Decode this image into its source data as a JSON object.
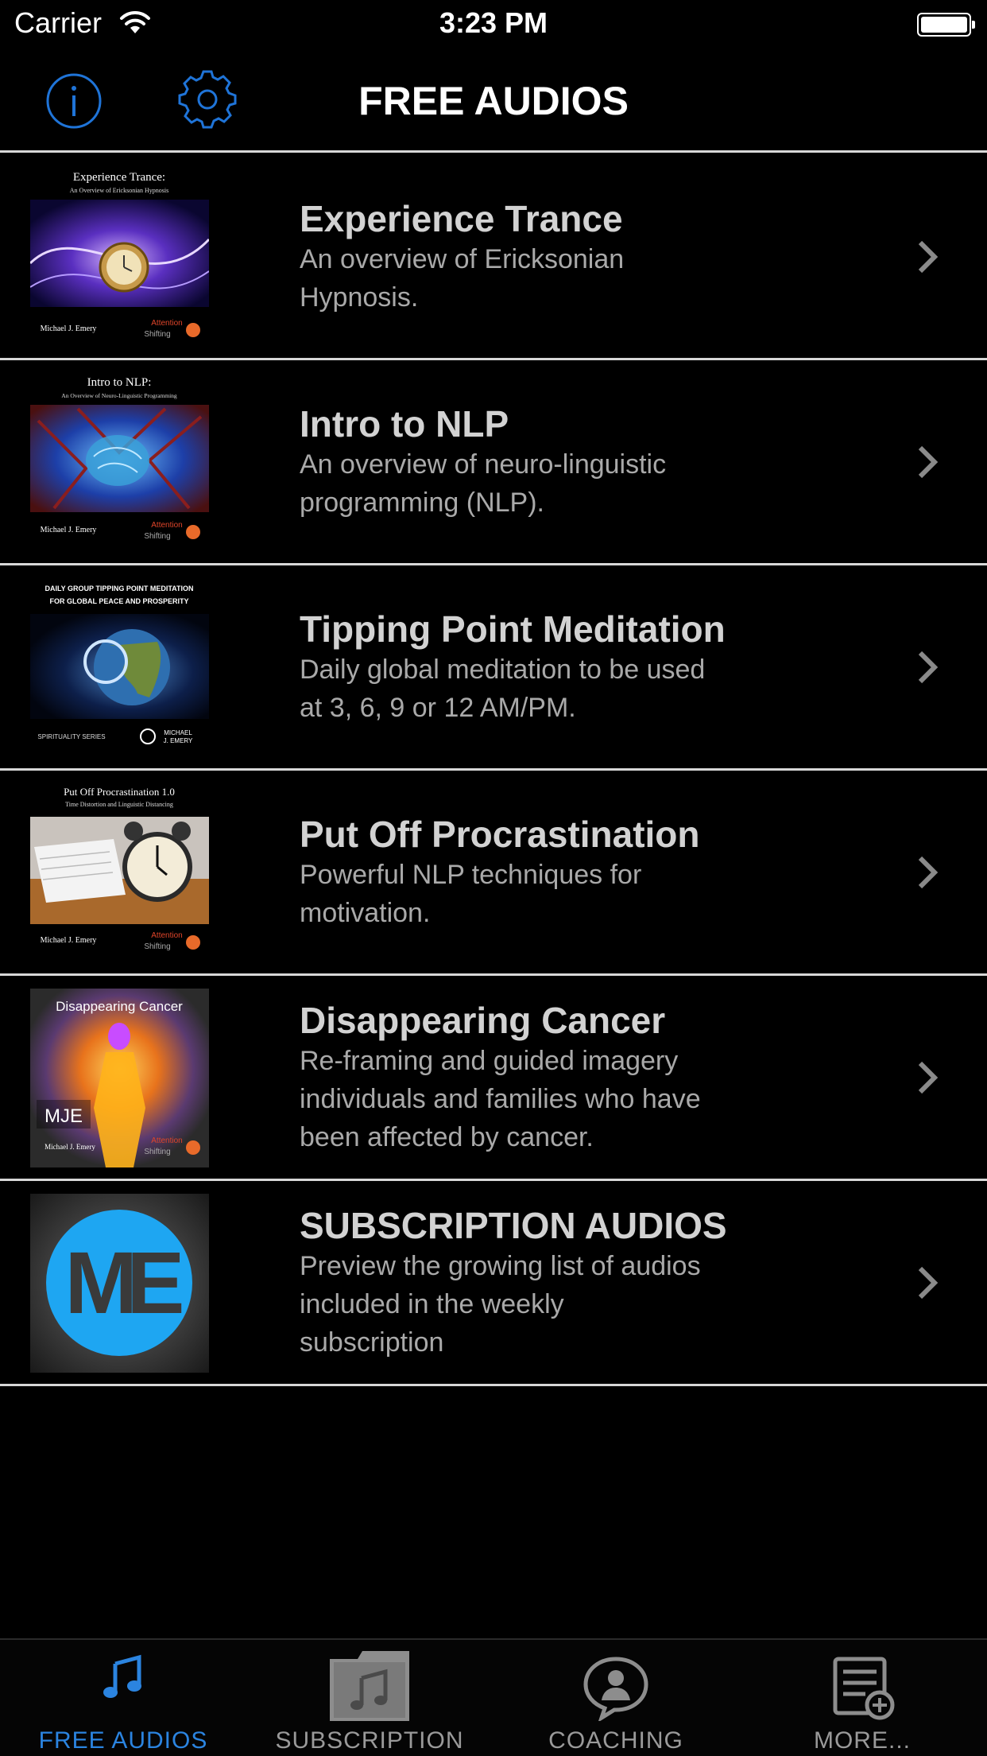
{
  "status_bar": {
    "carrier": "Carrier",
    "time": "3:23 PM"
  },
  "nav": {
    "title": "FREE AUDIOS",
    "accent_color": "#1f74d8"
  },
  "items": [
    {
      "title": "Experience Trance",
      "subtitle_lines": [
        "An overview of Ericksonian",
        "Hypnosis."
      ],
      "cover": {
        "heading": "Experience Trance:",
        "subheading": "An Overview of Ericksonian Hypnosis",
        "author": "Michael J. Emery",
        "brand_top": "Attention",
        "brand_bottom": "Shifting"
      }
    },
    {
      "title": "Intro to NLP",
      "subtitle_lines": [
        "An overview of neuro-linguistic",
        "programming (NLP)."
      ],
      "cover": {
        "heading": "Intro to NLP:",
        "subheading": "An Overview of Neuro-Linguistic Programming",
        "author": "Michael J. Emery",
        "brand_top": "Attention",
        "brand_bottom": "Shifting"
      }
    },
    {
      "title": "Tipping Point Meditation",
      "subtitle_lines": [
        "Daily global meditation to be used",
        "at 3, 6, 9 or 12 AM/PM."
      ],
      "cover": {
        "heading": "DAILY GROUP TIPPING POINT MEDITATION",
        "subheading": "FOR GLOBAL PEACE AND PROSPERITY",
        "author": "SPIRITUALITY SERIES",
        "brand_top": "MICHAEL",
        "brand_bottom": "J. EMERY"
      }
    },
    {
      "title": "Put Off Procrastination",
      "subtitle_lines": [
        "Powerful NLP techniques for",
        "motivation."
      ],
      "cover": {
        "heading": "Put Off Procrastination 1.0",
        "subheading": "Time Distortion and Linguistic Distancing",
        "author": "Michael J. Emery",
        "brand_top": "Attention",
        "brand_bottom": "Shifting"
      }
    },
    {
      "title": "Disappearing Cancer",
      "subtitle_lines": [
        "Re-framing and guided imagery",
        "individuals and families who have",
        "been affected by cancer."
      ],
      "cover": {
        "heading": "Disappearing Cancer",
        "subheading": "MJE",
        "author": "Michael J. Emery",
        "brand_top": "Attention",
        "brand_bottom": "Shifting"
      }
    },
    {
      "title": "SUBSCRIPTION AUDIOS",
      "subtitle_lines": [
        "Preview the growing list of audios",
        "included in the weekly",
        "subscription"
      ],
      "cover": {
        "logo_text": "ME"
      }
    }
  ],
  "tabs": [
    {
      "label": "FREE AUDIOS",
      "icon": "music-note-icon",
      "active": true
    },
    {
      "label": "SUBSCRIPTION",
      "icon": "music-folder-icon",
      "active": false
    },
    {
      "label": "COACHING",
      "icon": "person-chat-icon",
      "active": false
    },
    {
      "label": "MORE...",
      "icon": "list-add-icon",
      "active": false
    }
  ]
}
